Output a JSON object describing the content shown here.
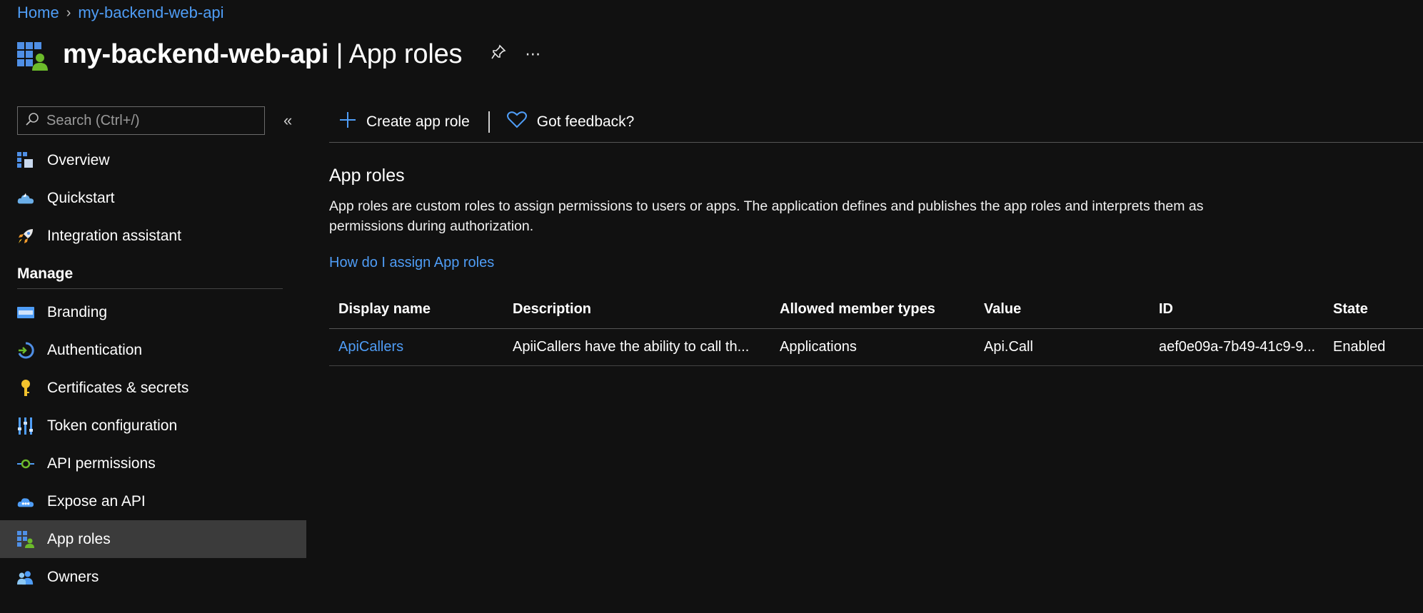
{
  "breadcrumb": {
    "home": "Home",
    "current": "my-backend-web-api"
  },
  "header": {
    "app_name": "my-backend-web-api",
    "separator": " | ",
    "page": "App roles"
  },
  "search": {
    "placeholder": "Search (Ctrl+/)",
    "value": ""
  },
  "sidebar": {
    "items_top": [
      {
        "label": "Overview",
        "icon": "overview-icon"
      },
      {
        "label": "Quickstart",
        "icon": "quickstart-icon"
      },
      {
        "label": "Integration assistant",
        "icon": "rocket-icon"
      }
    ],
    "manage_header": "Manage",
    "items_manage": [
      {
        "label": "Branding",
        "icon": "branding-icon"
      },
      {
        "label": "Authentication",
        "icon": "authentication-icon"
      },
      {
        "label": "Certificates & secrets",
        "icon": "key-icon"
      },
      {
        "label": "Token configuration",
        "icon": "token-config-icon"
      },
      {
        "label": "API permissions",
        "icon": "api-permissions-icon"
      },
      {
        "label": "Expose an API",
        "icon": "expose-api-icon"
      },
      {
        "label": "App roles",
        "icon": "app-roles-icon",
        "active": true
      },
      {
        "label": "Owners",
        "icon": "owners-icon"
      }
    ]
  },
  "toolbar": {
    "create_label": "Create app role",
    "feedback_label": "Got feedback?"
  },
  "main": {
    "section_title": "App roles",
    "description": "App roles are custom roles to assign permissions to users or apps. The application defines and publishes the app roles and interprets them as permissions during authorization.",
    "help_link": "How do I assign App roles"
  },
  "table": {
    "headers": [
      "Display name",
      "Description",
      "Allowed member types",
      "Value",
      "ID",
      "State"
    ],
    "rows": [
      [
        "ApiCallers",
        "ApiiCallers have the ability to call th...",
        "Applications",
        "Api.Call",
        "aef0e09a-7b49-41c9-9...",
        "Enabled"
      ]
    ]
  },
  "colors": {
    "accent": "#4f9df6",
    "background": "#111111",
    "active_nav": "#3b3b3b"
  }
}
